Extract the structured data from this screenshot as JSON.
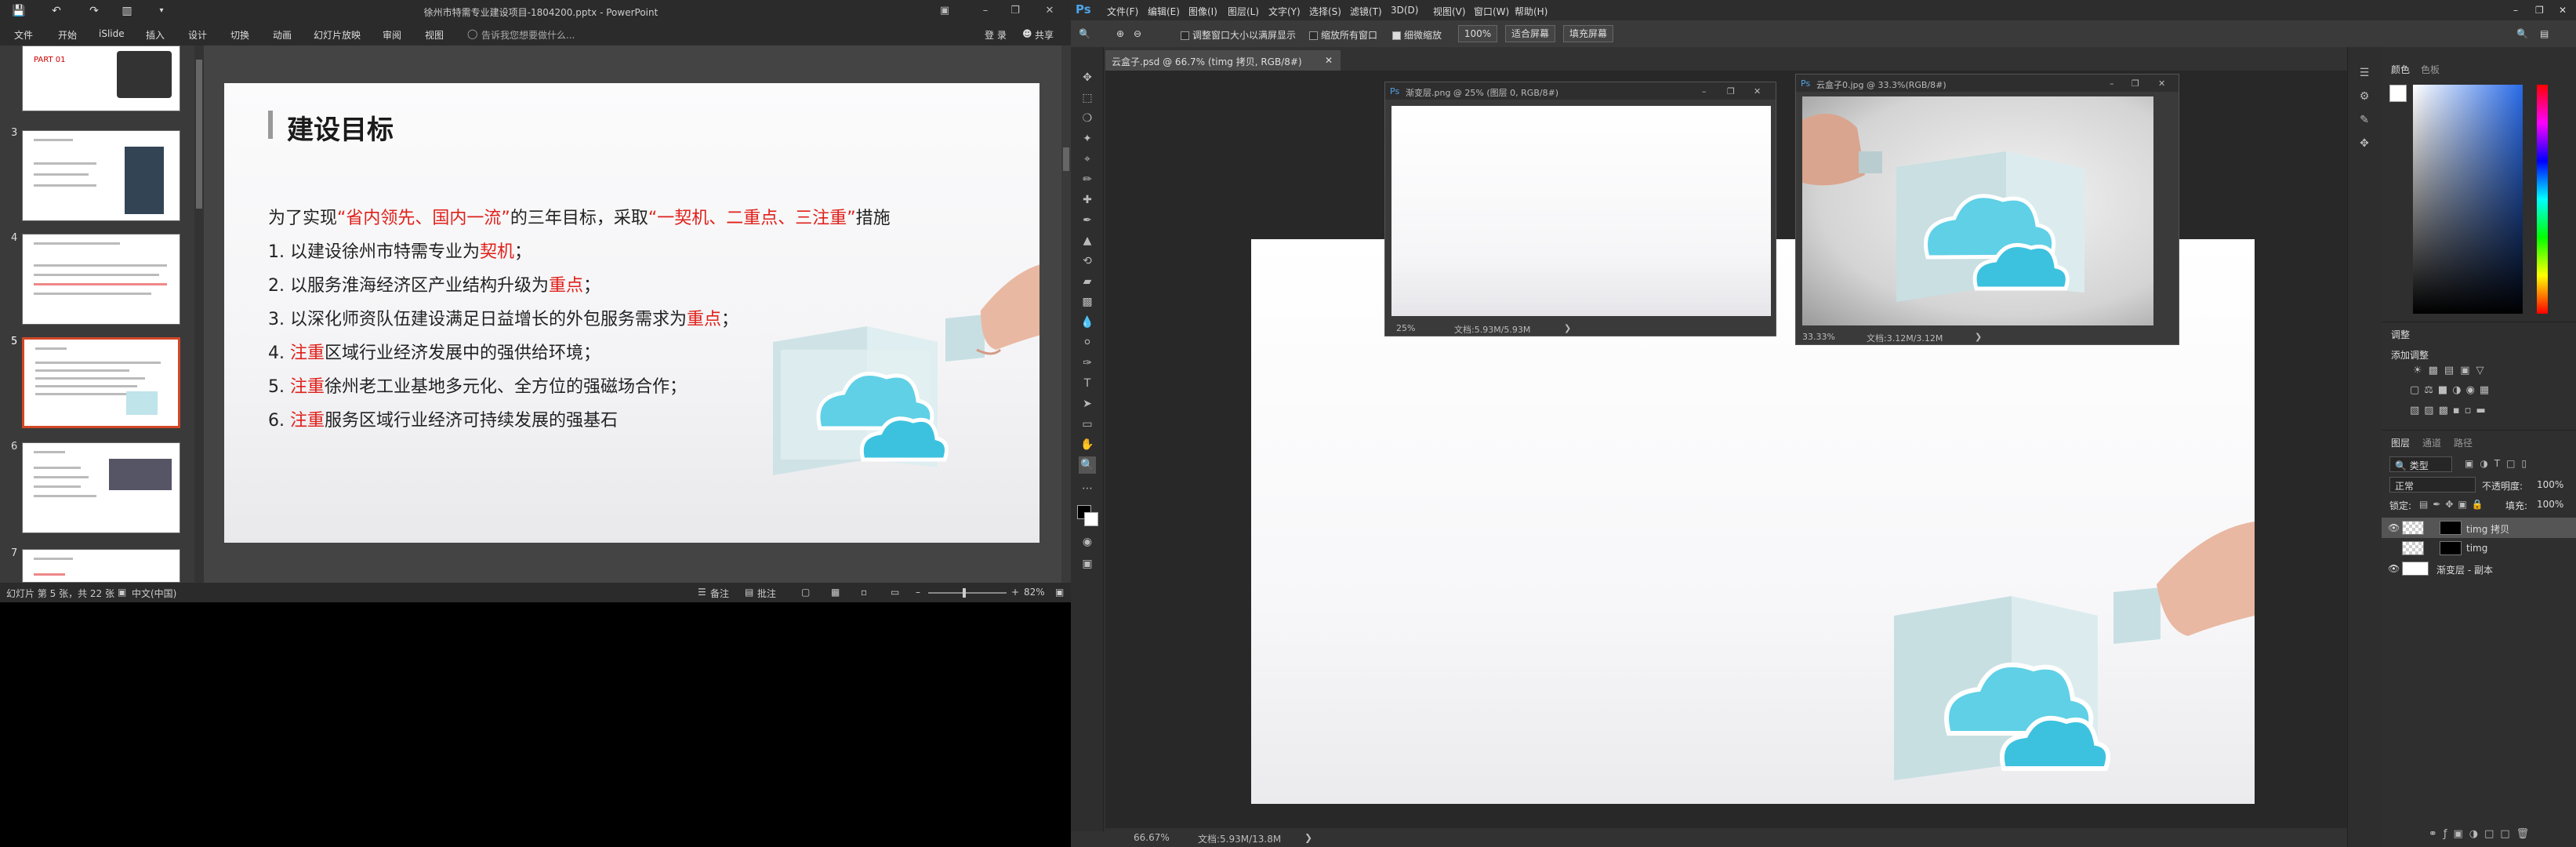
{
  "ppt": {
    "title": "徐州市特需专业建设项目-1804200.pptx - PowerPoint",
    "menu": [
      "文件",
      "开始",
      "iSlide",
      "插入",
      "设计",
      "切换",
      "动画",
      "幻灯片放映",
      "审阅",
      "视图"
    ],
    "tell_me": "告诉我您想要做什么...",
    "login": "登 录",
    "share": "共享",
    "thumb_numbers": [
      "3",
      "4",
      "5",
      "6",
      "7"
    ],
    "slide": {
      "heading": "建设目标",
      "intro_pre": "为了实现",
      "intro_red1": "“省内领先、国内一流”",
      "intro_mid": "的三年目标，采取",
      "intro_red2": "“一契机、二重点、三注重”",
      "intro_post": "措施",
      "items": [
        {
          "pre": "1.  以建设徐州市特需专业为",
          "red": "契机",
          "post": "；"
        },
        {
          "pre": "2.  以服务淮海经济区产业结构升级为",
          "red": "重点",
          "post": "；"
        },
        {
          "pre": "3.  以深化师资队伍建设满足日益增长的外包服务需求为",
          "red": "重点",
          "post": "；"
        },
        {
          "pre": "4.  ",
          "red": "注重",
          "post": "区域行业经济发展中的强供给环境；"
        },
        {
          "pre": "5.  ",
          "red": "注重",
          "post": "徐州老工业基地多元化、全方位的强磁场合作；"
        },
        {
          "pre": "6.  ",
          "red": "注重",
          "post": "服务区域行业经济可持续发展的强基石"
        }
      ]
    },
    "status": {
      "slide_info": "幻灯片 第 5 张，共 22 张",
      "language": "中文(中国)",
      "notes": "备注",
      "comments": "批注",
      "zoom": "82%"
    }
  },
  "ps": {
    "logo": "Ps",
    "menu": [
      "文件(F)",
      "编辑(E)",
      "图像(I)",
      "图层(L)",
      "文字(Y)",
      "选择(S)",
      "滤镜(T)",
      "3D(D)",
      "视图(V)",
      "窗口(W)",
      "帮助(H)"
    ],
    "options": {
      "resize_windows": "调整窗口大小以满屏显示",
      "zoom_all": "缩放所有窗口",
      "scrubby": "细微缩放",
      "zoom_value": "100%",
      "fit_screen": "适合屏幕",
      "fill_screen": "填充屏幕"
    },
    "doc_tab": "云盒子.psd @ 66.7% (timg 拷贝, RGB/8#)",
    "float1": {
      "title": "渐变层.png @ 25% (图层 0, RGB/8#)",
      "zoom": "25%",
      "doc": "文档:5.93M/5.93M"
    },
    "float2": {
      "title": "云盒子0.jpg @ 33.3%(RGB/8#)",
      "zoom": "33.33%",
      "doc": "文档:3.12M/3.12M"
    },
    "status": {
      "zoom": "66.67%",
      "doc": "文档:5.93M/13.8M"
    },
    "color_tabs": [
      "颜色",
      "色板"
    ],
    "adjust": {
      "tab": "调整",
      "add": "添加调整"
    },
    "layers": {
      "tabs": [
        "图层",
        "通道",
        "路径"
      ],
      "kind": "类型",
      "blend": "正常",
      "opacity_label": "不透明度:",
      "opacity": "100%",
      "lock": "锁定:",
      "fill_label": "填充:",
      "fill": "100%",
      "items": [
        "timg 拷贝",
        "timg",
        "渐变层 - 副本"
      ]
    }
  }
}
